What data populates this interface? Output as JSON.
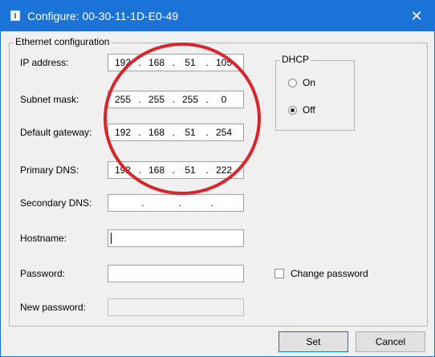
{
  "window": {
    "title": "Configure: 00-30-11-1D-E0-49",
    "close_glyph": "✕"
  },
  "ethernet": {
    "legend": "Ethernet configuration",
    "ip_address": {
      "label": "IP address:",
      "octets": [
        "192",
        "168",
        "51",
        "105"
      ]
    },
    "subnet_mask": {
      "label": "Subnet mask:",
      "octets": [
        "255",
        "255",
        "255",
        "0"
      ]
    },
    "default_gateway": {
      "label": "Default gateway:",
      "octets": [
        "192",
        "168",
        "51",
        "254"
      ]
    },
    "primary_dns": {
      "label": "Primary DNS:",
      "octets": [
        "192",
        "168",
        "51",
        "222"
      ]
    },
    "secondary_dns": {
      "label": "Secondary DNS:",
      "octets": [
        "",
        "",
        "",
        ""
      ]
    },
    "hostname": {
      "label": "Hostname:",
      "value": ""
    },
    "password": {
      "label": "Password:",
      "value": ""
    },
    "new_password": {
      "label": "New password:",
      "value": ""
    }
  },
  "dhcp": {
    "legend": "DHCP",
    "on_label": "On",
    "off_label": "Off",
    "selected": "Off"
  },
  "change_password": {
    "label": "Change password",
    "checked": false
  },
  "buttons": {
    "set": "Set",
    "cancel": "Cancel"
  },
  "colors": {
    "titlebar": "#1a74d8",
    "annotation_circle": "#d8262a"
  }
}
